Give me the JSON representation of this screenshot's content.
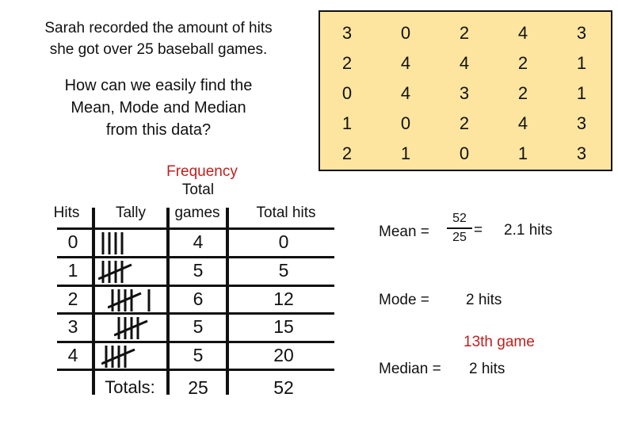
{
  "intro": {
    "line1": "Sarah recorded the amount of hits",
    "line2": "she got over 25 baseball games."
  },
  "question": {
    "line1": "How can we easily find the",
    "line2": "Mean, Mode and Median",
    "line3": "from this data?"
  },
  "raw_data": {
    "rows": [
      [
        "3",
        "0",
        "2",
        "4",
        "3"
      ],
      [
        "2",
        "4",
        "4",
        "2",
        "1"
      ],
      [
        "0",
        "4",
        "3",
        "2",
        "1"
      ],
      [
        "1",
        "0",
        "2",
        "4",
        "3"
      ],
      [
        "2",
        "1",
        "0",
        "1",
        "3"
      ]
    ],
    "background_color": "#fde59f"
  },
  "table": {
    "headers": {
      "frequency_note": "Frequency",
      "hits": "Hits",
      "tally": "Tally",
      "total_games_line1": "Total",
      "total_games_line2": "games",
      "total_hits": "Total hits"
    },
    "rows": [
      {
        "hits": "0",
        "tally_count": 4,
        "games": "4",
        "total_hits": "0"
      },
      {
        "hits": "1",
        "tally_count": 5,
        "games": "5",
        "total_hits": "5"
      },
      {
        "hits": "2",
        "tally_count": 6,
        "games": "6",
        "total_hits": "12"
      },
      {
        "hits": "3",
        "tally_count": 5,
        "games": "5",
        "total_hits": "15"
      },
      {
        "hits": "4",
        "tally_count": 5,
        "games": "5",
        "total_hits": "20"
      }
    ],
    "totals": {
      "label": "Totals:",
      "games": "25",
      "total_hits": "52"
    }
  },
  "results": {
    "mean_label": "Mean =",
    "mean_numerator": "52",
    "mean_denominator": "25",
    "mean_equals": "=",
    "mean_value": "2.1 hits",
    "mode_label": "Mode =",
    "mode_value": "2 hits",
    "median_note": "13th game",
    "median_label": "Median =",
    "median_value": "2 hits"
  },
  "colors": {
    "accent_red": "#c0201e",
    "box_fill": "#fde59f"
  }
}
